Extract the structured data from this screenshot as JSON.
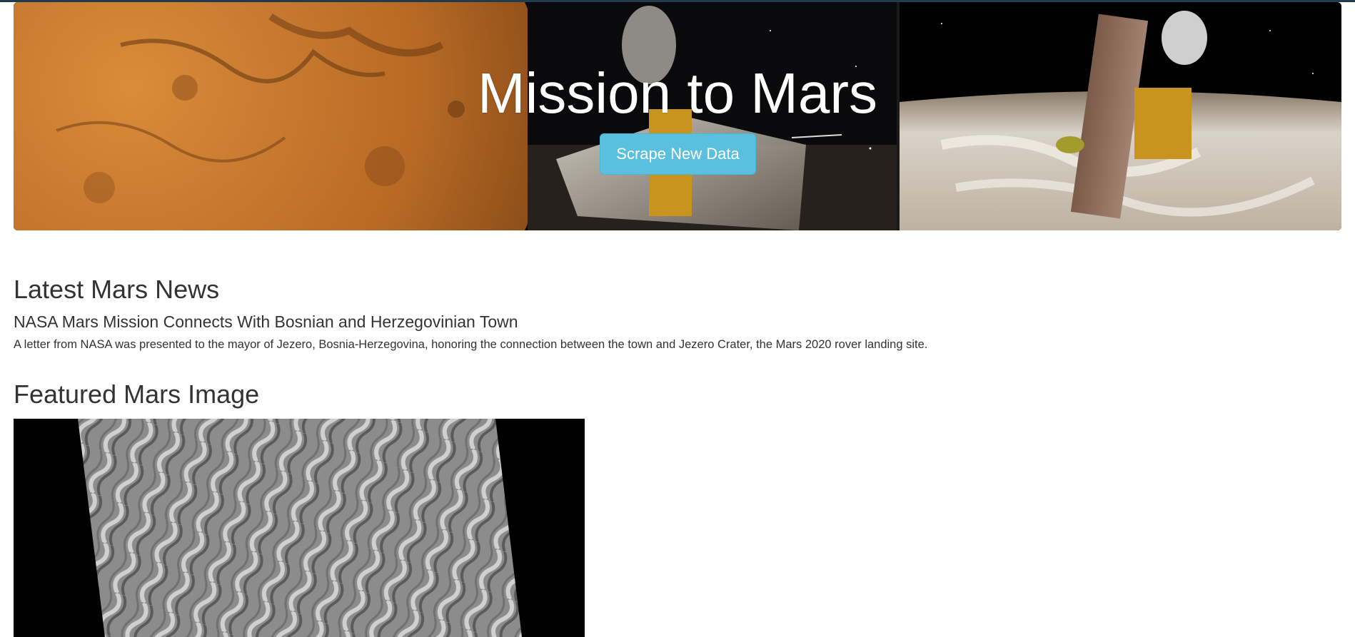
{
  "header": {
    "title": "Mission to Mars",
    "scrape_button_label": "Scrape New Data"
  },
  "news": {
    "heading": "Latest Mars News",
    "title": "NASA Mars Mission Connects With Bosnian and Herzegovinian Town",
    "teaser": "A letter from NASA was presented to the mayor of Jezero, Bosnia-Herzegovina, honoring the connection between the town and Jezero Crater, the Mars 2020 rover landing site."
  },
  "featured_image": {
    "heading": "Featured Mars Image"
  },
  "colors": {
    "button": "#5bc0de",
    "text": "#333333",
    "topbar": "#1f3b4d"
  }
}
